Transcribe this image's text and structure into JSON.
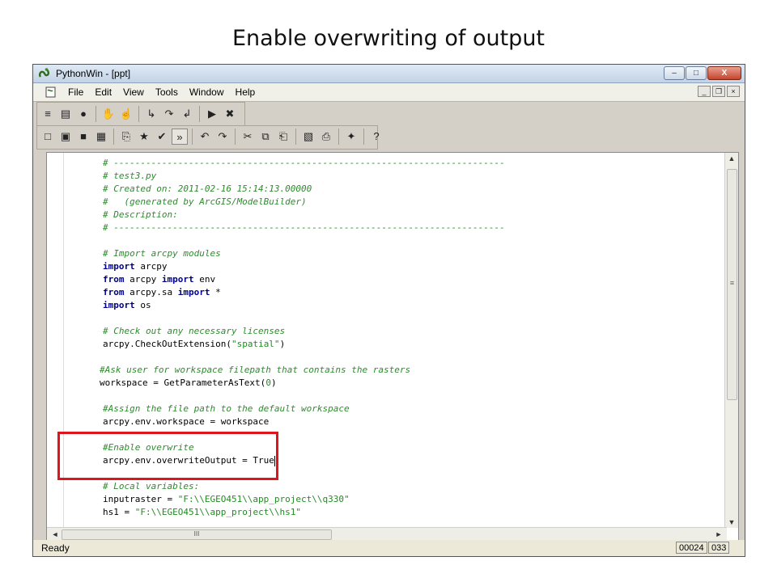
{
  "slide": {
    "title": "Enable overwriting of output"
  },
  "window": {
    "title": "PythonWin - [ppt]",
    "controls": {
      "minimize": "–",
      "maximize": "□",
      "close": "X"
    }
  },
  "menubar": {
    "items": [
      "File",
      "Edit",
      "View",
      "Tools",
      "Window",
      "Help"
    ],
    "mdi_controls": {
      "minimize": "_",
      "restore": "❐",
      "close": "×"
    }
  },
  "toolbar1": {
    "icons": [
      "watch-icon",
      "list-icon",
      "breakpoint-icon",
      "hand-icon",
      "hand-cursor-icon",
      "step-into-icon",
      "step-over-icon",
      "step-out-icon",
      "run-icon",
      "stop-debug-icon"
    ],
    "glyphs": [
      "≡",
      "▤",
      "●",
      "✋",
      "☝",
      "↳",
      "↷",
      "↲",
      "▶",
      "✖"
    ]
  },
  "toolbar2": {
    "icons": [
      "new-file-icon",
      "open-folder-icon",
      "save-icon",
      "save-all-icon",
      "copy-format-icon",
      "run-script-icon",
      "check-icon",
      "whitespace-icon",
      "undo-icon",
      "redo-icon",
      "cut-icon",
      "copy-icon",
      "paste-icon",
      "print-preview-icon",
      "print-icon",
      "python-icon",
      "help-icon"
    ],
    "glyphs": [
      "□",
      "▣",
      "■",
      "▦",
      "⎘",
      "★",
      "✔",
      "»",
      "↶",
      "↷",
      "✂",
      "⧉",
      "⎗",
      "▧",
      "⎙",
      "✦",
      "?"
    ]
  },
  "code": {
    "lines": [
      {
        "indent": 1,
        "tokens": [
          {
            "t": "# -------------------------------------------------------------------------",
            "c": "comment"
          }
        ]
      },
      {
        "indent": 1,
        "tokens": [
          {
            "t": "# test3.py",
            "c": "comment"
          }
        ]
      },
      {
        "indent": 1,
        "tokens": [
          {
            "t": "# Created on: 2011-02-16 15:14:13.00000",
            "c": "comment"
          }
        ]
      },
      {
        "indent": 1,
        "tokens": [
          {
            "t": "#   (generated by ArcGIS/ModelBuilder)",
            "c": "comment"
          }
        ]
      },
      {
        "indent": 1,
        "tokens": [
          {
            "t": "# Description:",
            "c": "comment"
          }
        ]
      },
      {
        "indent": 1,
        "tokens": [
          {
            "t": "# -------------------------------------------------------------------------",
            "c": "comment"
          }
        ]
      },
      {
        "indent": 1,
        "tokens": []
      },
      {
        "indent": 1,
        "tokens": [
          {
            "t": "# Import arcpy modules",
            "c": "comment"
          }
        ]
      },
      {
        "indent": 1,
        "tokens": [
          {
            "t": "import",
            "c": "kw"
          },
          {
            "t": " arcpy",
            "c": "plain"
          }
        ]
      },
      {
        "indent": 1,
        "tokens": [
          {
            "t": "from",
            "c": "kw"
          },
          {
            "t": " arcpy ",
            "c": "plain"
          },
          {
            "t": "import",
            "c": "kw"
          },
          {
            "t": " env",
            "c": "plain"
          }
        ]
      },
      {
        "indent": 1,
        "tokens": [
          {
            "t": "from",
            "c": "kw"
          },
          {
            "t": " arcpy.sa ",
            "c": "plain"
          },
          {
            "t": "import",
            "c": "kw"
          },
          {
            "t": " *",
            "c": "plain"
          }
        ]
      },
      {
        "indent": 1,
        "tokens": [
          {
            "t": "import",
            "c": "kw"
          },
          {
            "t": " os",
            "c": "plain"
          }
        ]
      },
      {
        "indent": 1,
        "tokens": []
      },
      {
        "indent": 1,
        "tokens": [
          {
            "t": "# Check out any necessary licenses",
            "c": "comment"
          }
        ]
      },
      {
        "indent": 1,
        "tokens": [
          {
            "t": "arcpy.CheckOutExtension(",
            "c": "plain"
          },
          {
            "t": "\"spatial\"",
            "c": "str"
          },
          {
            "t": ")",
            "c": "plain"
          }
        ]
      },
      {
        "indent": 1,
        "tokens": []
      },
      {
        "indent": 0,
        "tokens": [
          {
            "t": "#Ask user for workspace filepath that contains the rasters",
            "c": "comment"
          }
        ]
      },
      {
        "indent": 0,
        "tokens": [
          {
            "t": "workspace = GetParameterAsText(",
            "c": "plain"
          },
          {
            "t": "0",
            "c": "num"
          },
          {
            "t": ")",
            "c": "plain"
          }
        ]
      },
      {
        "indent": 1,
        "tokens": []
      },
      {
        "indent": 1,
        "tokens": [
          {
            "t": "#Assign the file path to the default workspace",
            "c": "comment"
          }
        ]
      },
      {
        "indent": 1,
        "tokens": [
          {
            "t": "arcpy.env.workspace = workspace",
            "c": "plain"
          }
        ]
      },
      {
        "indent": 1,
        "tokens": []
      },
      {
        "indent": 1,
        "tokens": [
          {
            "t": "#Enable overwrite",
            "c": "comment"
          }
        ]
      },
      {
        "indent": 1,
        "tokens": [
          {
            "t": "arcpy.env.overwriteOutput = True",
            "c": "plain"
          }
        ],
        "caret": true
      },
      {
        "indent": 1,
        "tokens": []
      },
      {
        "indent": 1,
        "tokens": [
          {
            "t": "# Local variables:",
            "c": "comment"
          }
        ]
      },
      {
        "indent": 1,
        "tokens": [
          {
            "t": "inputraster = ",
            "c": "plain"
          },
          {
            "t": "\"F:\\\\EGEO451\\\\app_project\\\\q330\"",
            "c": "str"
          }
        ]
      },
      {
        "indent": 1,
        "tokens": [
          {
            "t": "hs1 = ",
            "c": "plain"
          },
          {
            "t": "\"F:\\\\EGEO451\\\\app_project\\\\hs1\"",
            "c": "str"
          }
        ]
      }
    ]
  },
  "scrollbar": {
    "hthumb_grip": "III",
    "vthumb_grip": "≡"
  },
  "statusbar": {
    "text": "Ready",
    "line": "00024",
    "col": "033"
  },
  "colors": {
    "highlight": "#e0151b"
  }
}
